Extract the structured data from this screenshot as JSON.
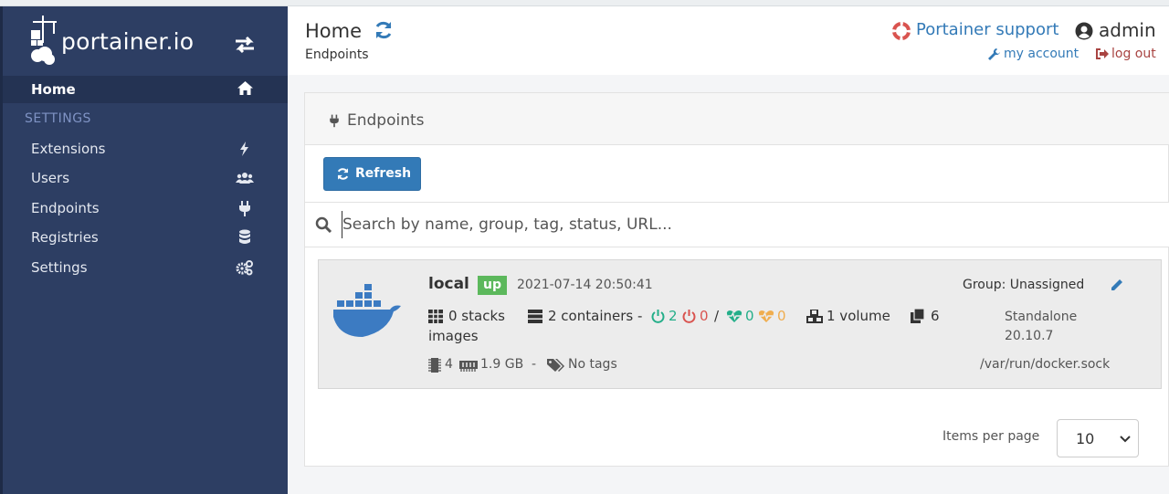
{
  "brand": {
    "name": "portainer.io"
  },
  "sidebar": {
    "home_label": "Home",
    "settings_heading": "SETTINGS",
    "items": [
      {
        "label": "Extensions",
        "icon": "bolt-icon"
      },
      {
        "label": "Users",
        "icon": "users-icon"
      },
      {
        "label": "Endpoints",
        "icon": "plug-icon"
      },
      {
        "label": "Registries",
        "icon": "database-icon"
      },
      {
        "label": "Settings",
        "icon": "cogs-icon"
      }
    ]
  },
  "header": {
    "title": "Home",
    "breadcrumb": "Endpoints",
    "support_label": "Portainer support",
    "username": "admin",
    "my_account_label": "my account",
    "log_out_label": "log out"
  },
  "widget": {
    "title": "Endpoints",
    "refresh_label": "Refresh",
    "search_placeholder": "Search by name, group, tag, status, URL..."
  },
  "endpoint": {
    "name": "local",
    "status": "up",
    "timestamp": "2021-07-14 20:50:41",
    "group": "Group: Unassigned",
    "stacks": "0 stacks",
    "containers": "2 containers -",
    "running": "2",
    "stopped": "0",
    "slash": "/",
    "healthy": "0",
    "unhealthy": "0",
    "volumes": "1 volume",
    "images_count": "6",
    "images_word": "images",
    "cpu": "4",
    "memory": "1.9 GB",
    "dash": "-",
    "tags": "No tags",
    "type_line1": "Standalone",
    "type_line2": "20.10.7",
    "url": "/var/run/docker.sock"
  },
  "pagination": {
    "label": "Items per page",
    "value": "10"
  },
  "colors": {
    "sidebar_bg": "#2d3e63",
    "primary": "#337ab7",
    "success": "#5cb85c",
    "danger": "#d9534f",
    "docker_blue": "#3c7bc2"
  }
}
